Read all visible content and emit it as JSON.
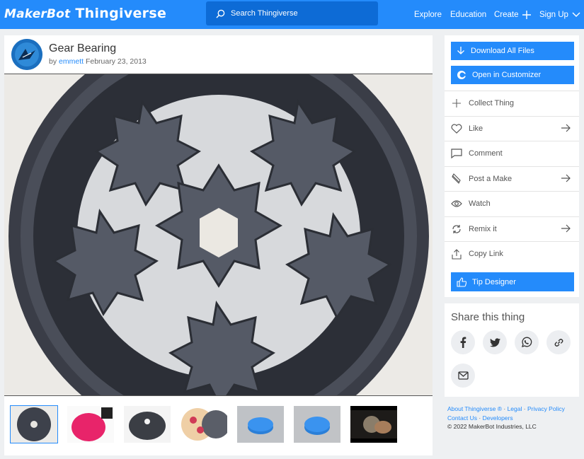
{
  "header": {
    "brand_makerbot": "MakerBot",
    "brand_thingiverse": "Thingiverse",
    "search_placeholder": "Search Thingiverse",
    "nav": {
      "explore": "Explore",
      "education": "Education",
      "create": "Create",
      "signup": "Sign Up"
    }
  },
  "thing": {
    "title": "Gear Bearing",
    "by": "by",
    "author": "emmett",
    "date": "February 23, 2013"
  },
  "thumbnails": [
    "gear-bearing-top",
    "pink-print",
    "black-dome",
    "colored-gears",
    "blue-bearing-1",
    "blue-bearing-2",
    "hand-held-photo"
  ],
  "sidebar": {
    "download": "Download All Files",
    "customizer": "Open in Customizer",
    "actions": {
      "collect": "Collect Thing",
      "like": "Like",
      "comment": "Comment",
      "make": "Post a Make",
      "watch": "Watch",
      "remix": "Remix it",
      "copy": "Copy Link"
    },
    "tip": "Tip Designer"
  },
  "share": {
    "title": "Share this thing"
  },
  "footer": {
    "about": "About Thingiverse ®",
    "legal": "Legal",
    "privacy": "Privacy Policy",
    "contact": "Contact Us",
    "developers": "Developers",
    "copyright": "© 2022 MakerBot Industries, LLC"
  },
  "colors": {
    "accent": "#248bfb",
    "search_bg": "#0d6bd6"
  }
}
